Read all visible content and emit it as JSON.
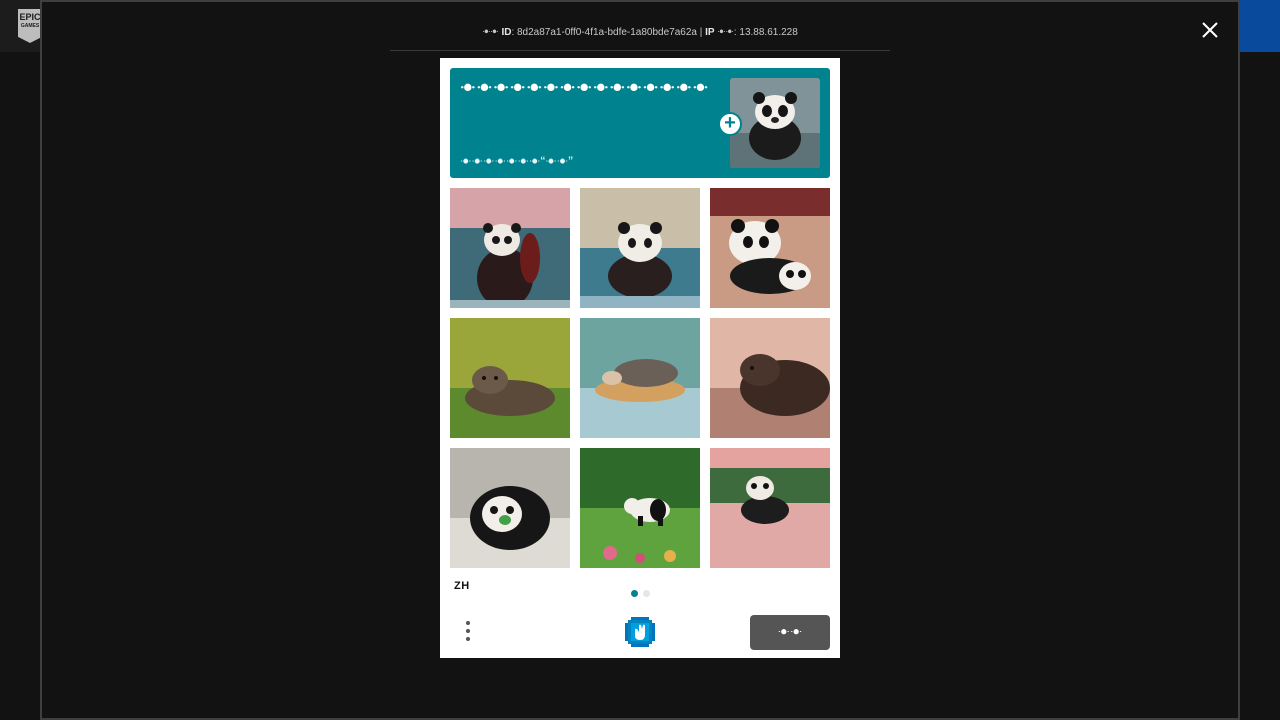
{
  "header": {
    "logo_text": "EPIC",
    "logo_subtext": "GAMES"
  },
  "modal": {
    "session": {
      "id_prefix": "ꔹꔹ",
      "id_label": "ID",
      "id_value": "8d2a87a1-0ff0-4f1a-bdfe-1a80bde7a62a",
      "separator": "|",
      "ip_label": "IP",
      "ip_suffix": "ꔹꔹ",
      "ip_value": "13.88.61.228"
    },
    "close_icon": "close-icon"
  },
  "captcha": {
    "prompt_title": "ꔹꔹꔹꔹꔹꔹꔹꔹꔹꔹꔹꔹꔹꔹꔹ",
    "prompt_subtitle": "ꔹꔹꔹꔹꔹꔹꔹ“ꔹꔹ”",
    "example_image": "panda",
    "tiles": [
      {
        "subject": "panda-waving-water"
      },
      {
        "subject": "panda-in-water"
      },
      {
        "subject": "pandas-on-couch"
      },
      {
        "subject": "otter-in-grass"
      },
      {
        "subject": "hedgehog-on-rock"
      },
      {
        "subject": "otter-on-shore"
      },
      {
        "subject": "panda-on-armchair"
      },
      {
        "subject": "panda-in-garden"
      },
      {
        "subject": "panda-in-lake"
      }
    ],
    "language": "ZH",
    "page_count": 2,
    "current_page": 1,
    "next_button": "ꔹꔹ",
    "accent_color": "#00838f"
  }
}
